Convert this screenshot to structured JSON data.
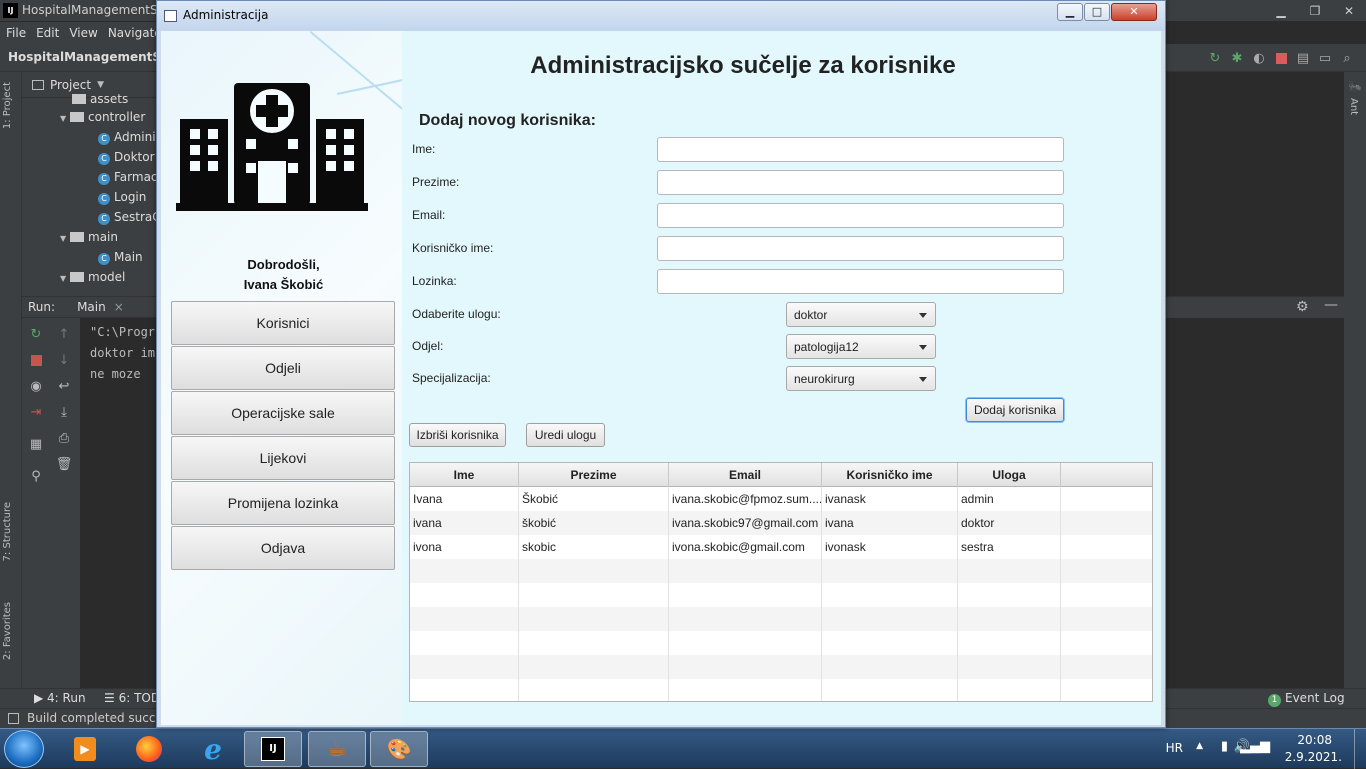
{
  "ide": {
    "title": "HospitalManagementSys",
    "menu": [
      "File",
      "Edit",
      "View",
      "Navigate"
    ],
    "project_name": "HospitalManagementS",
    "project_tool": "Project",
    "left_tabs": [
      "1: Project",
      "7: Structure",
      "2: Favorites"
    ],
    "right_tabs": [
      "Ant"
    ],
    "tree": [
      {
        "label": "assets",
        "kind": "folder"
      },
      {
        "label": "controller",
        "kind": "folder"
      },
      {
        "label": "Admini",
        "kind": "class"
      },
      {
        "label": "Doktor",
        "kind": "class"
      },
      {
        "label": "Farmac",
        "kind": "class"
      },
      {
        "label": "Login",
        "kind": "class"
      },
      {
        "label": "SestraC",
        "kind": "class"
      },
      {
        "label": "main",
        "kind": "folder"
      },
      {
        "label": "Main",
        "kind": "class"
      },
      {
        "label": "model",
        "kind": "folder"
      }
    ],
    "run_label": "Run:",
    "run_tab": "Main",
    "console": [
      "\"C:\\Progr",
      "doktor im",
      "ne moze"
    ],
    "bottom_tabs": {
      "run": "4: Run",
      "todo": "6: TOD",
      "event_log": "Event Log",
      "event_count": "1"
    },
    "status": "Build completed succes"
  },
  "dialog": {
    "title": "Administracija",
    "heading": "Administracijsko sučelje za korisnike",
    "welcome_line1": "Dobrodošli,",
    "welcome_line2": "Ivana Škobić",
    "nav": [
      "Korisnici",
      "Odjeli",
      "Operacijske sale",
      "Lijekovi",
      "Promijena lozinka",
      "Odjava"
    ],
    "form": {
      "section_title": "Dodaj novog korisnika:",
      "fields": [
        {
          "label": "Ime:",
          "value": ""
        },
        {
          "label": "Prezime:",
          "value": ""
        },
        {
          "label": "Email:",
          "value": ""
        },
        {
          "label": "Korisničko ime:",
          "value": ""
        },
        {
          "label": "Lozinka:",
          "value": ""
        }
      ],
      "role_label": "Odaberite ulogu:",
      "role_value": "doktor",
      "dept_label": "Odjel:",
      "dept_value": "patologija12",
      "spec_label": "Specijalizacija:",
      "spec_value": "neurokirurg",
      "add_button": "Dodaj korisnika"
    },
    "delete_button": "Izbriši korisnika",
    "edit_role_button": "Uredi ulogu",
    "table": {
      "columns": [
        "Ime",
        "Prezime",
        "Email",
        "Korisničko ime",
        "Uloga"
      ],
      "rows": [
        [
          "Ivana",
          "Škobić",
          "ivana.skobic@fpmoz.sum....",
          "ivanask",
          "admin"
        ],
        [
          "ivana",
          "škobić",
          "ivana.skobic97@gmail.com",
          "ivana",
          "doktor"
        ],
        [
          "ivona",
          "skobic",
          "ivona.skobic@gmail.com",
          "ivonask",
          "sestra"
        ]
      ]
    }
  },
  "taskbar": {
    "lang": "HR",
    "time": "20:08",
    "date": "2.9.2021."
  }
}
